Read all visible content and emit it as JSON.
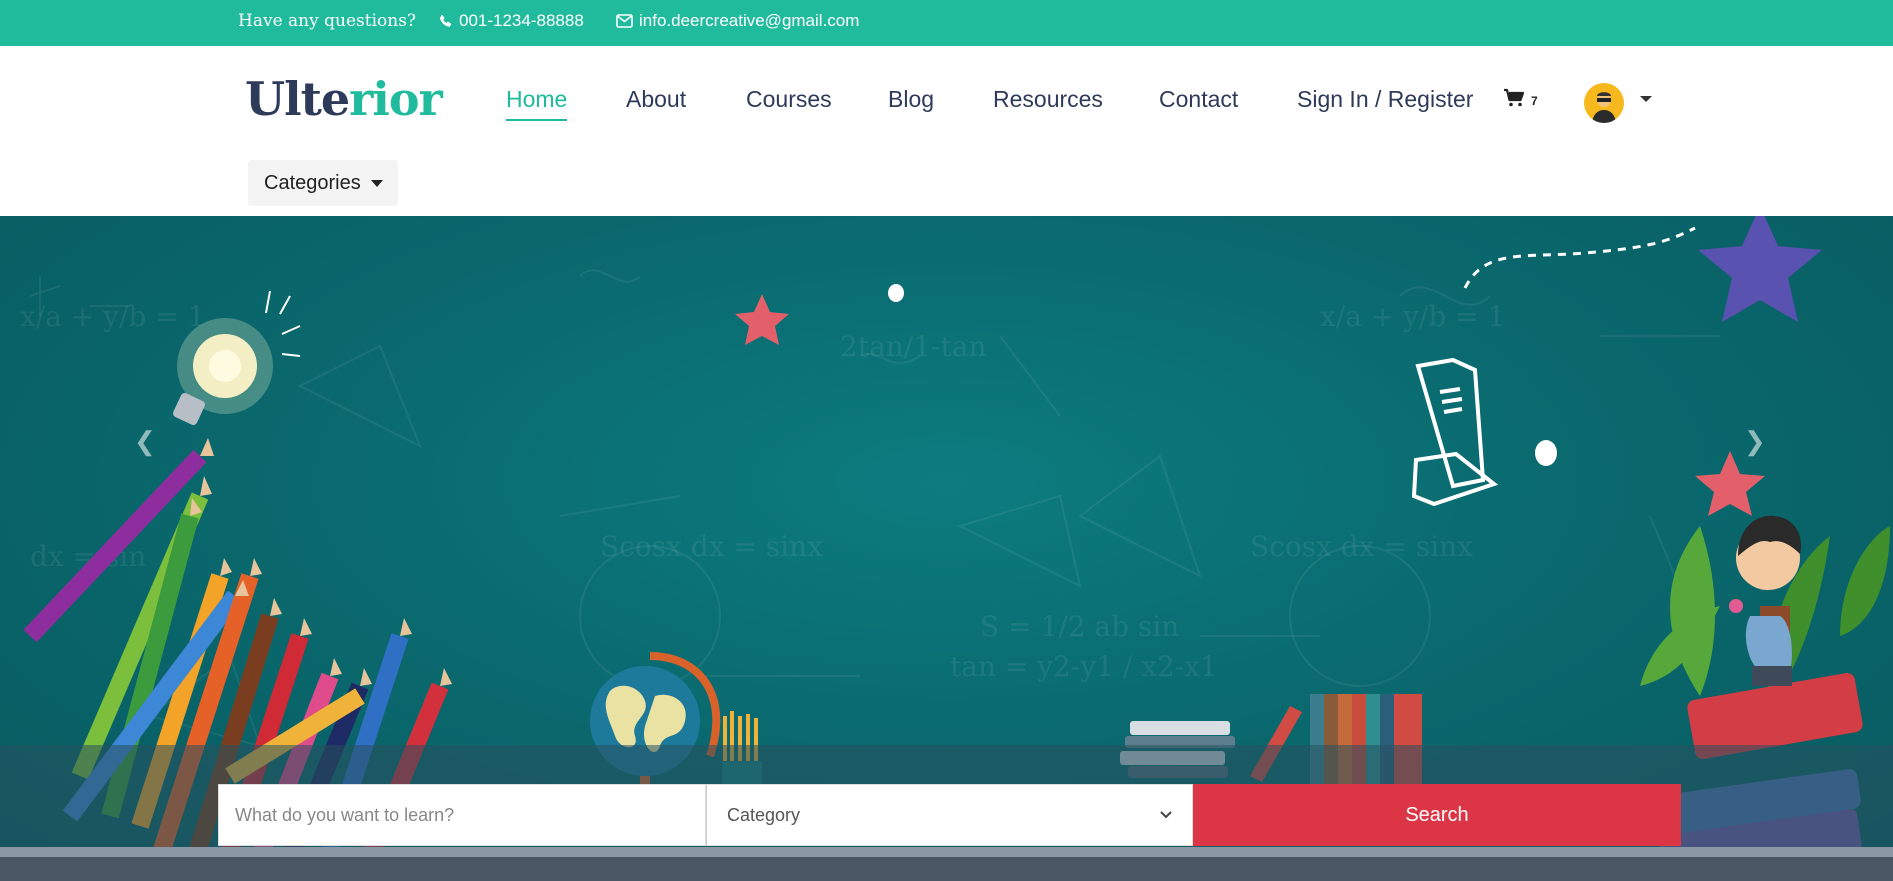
{
  "topbar": {
    "question": "Have any questions?",
    "phone": "001-1234-88888",
    "email": "info.deercreative@gmail.com"
  },
  "logo": {
    "part1": "Ulte",
    "part2": "rior"
  },
  "nav": {
    "items": [
      {
        "label": "Home",
        "active": true
      },
      {
        "label": "About"
      },
      {
        "label": "Courses"
      },
      {
        "label": "Blog"
      },
      {
        "label": "Resources"
      },
      {
        "label": "Contact"
      },
      {
        "label": "Sign In / Register"
      }
    ],
    "cart_count": "7",
    "categories_label": "Categories"
  },
  "search": {
    "placeholder": "What do you want to learn?",
    "category_label": "Category",
    "button_label": "Search"
  },
  "colors": {
    "accent": "#1fbb9c",
    "navy": "#2e3a59",
    "search_button": "#dc3545"
  },
  "icons": [
    "phone-icon",
    "envelope-icon",
    "cart-icon",
    "avatar",
    "chevron-left-icon",
    "chevron-right-icon"
  ]
}
